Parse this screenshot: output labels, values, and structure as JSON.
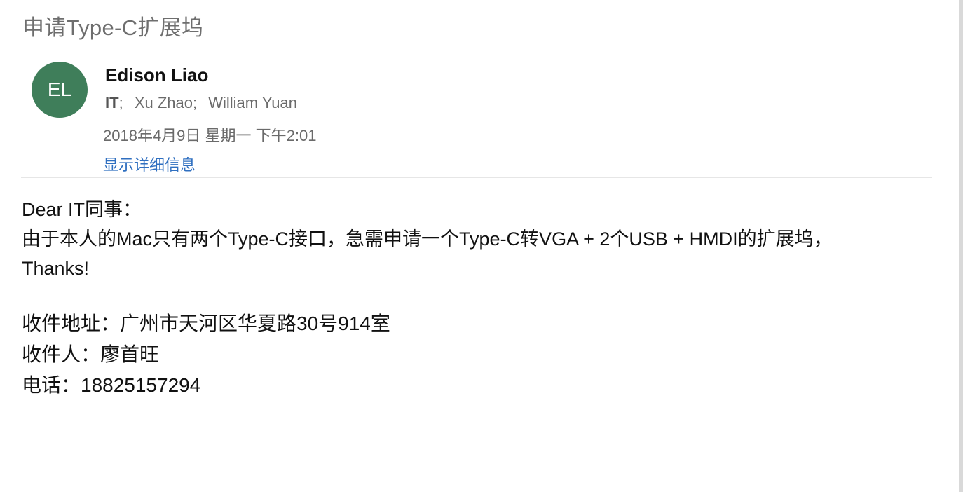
{
  "email": {
    "subject": "申请Type-C扩展坞",
    "sender": {
      "initials": "EL",
      "avatar_color": "#3f7e5a",
      "name": "Edison Liao"
    },
    "recipients": [
      {
        "name": "IT",
        "separator": ";"
      },
      {
        "name": "Xu Zhao",
        "separator": ";"
      },
      {
        "name": "William Yuan",
        "separator": ""
      }
    ],
    "date": "2018年4月9日 星期一 下午2:01",
    "details_link": "显示详细信息",
    "link_color": "#2f6fc0",
    "body": {
      "greeting": "Dear IT同事：",
      "request": "由于本人的Mac只有两个Type-C接口，急需申请一个Type-C转VGA + 2个USB + HMDI的扩展坞，",
      "thanks": "Thanks!",
      "address": "收件地址：广州市天河区华夏路30号914室",
      "recipient": "收件人：廖首旺",
      "phone": "电话：18825157294"
    }
  }
}
